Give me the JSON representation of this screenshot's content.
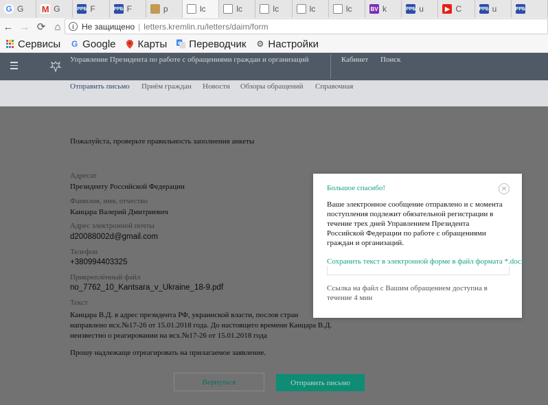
{
  "browser": {
    "tabs": [
      {
        "icon": "google-icon",
        "glyph": "G",
        "title": "G"
      },
      {
        "icon": "gmail-icon",
        "glyph": "M",
        "title": "G"
      },
      {
        "icon": "pf-icon",
        "glyph": "PPБ",
        "title": "F"
      },
      {
        "icon": "pf-icon",
        "glyph": "PPБ",
        "title": "F"
      },
      {
        "icon": "image-icon",
        "glyph": "",
        "title": "p"
      },
      {
        "icon": "document-icon",
        "glyph": "",
        "title": "lc"
      },
      {
        "icon": "document-icon",
        "glyph": "",
        "title": "lc"
      },
      {
        "icon": "document-icon",
        "glyph": "",
        "title": "lc"
      },
      {
        "icon": "document-icon",
        "glyph": "",
        "title": "lc"
      },
      {
        "icon": "document-icon",
        "glyph": "",
        "title": "lc"
      },
      {
        "icon": "bv-icon",
        "glyph": "BV",
        "title": "k"
      },
      {
        "icon": "pf-icon",
        "glyph": "PPБ",
        "title": "u"
      },
      {
        "icon": "youtube-icon",
        "glyph": "▶",
        "title": "C"
      },
      {
        "icon": "pf-icon",
        "glyph": "PPБ",
        "title": "u"
      },
      {
        "icon": "pf-icon",
        "glyph": "PPБ",
        "title": ""
      }
    ],
    "back": "←",
    "forward": "→",
    "reload": "⟳",
    "home": "⌂",
    "security_label": "Не защищено",
    "url": "letters.kremlin.ru/letters/daim/form"
  },
  "bookmarks": [
    {
      "label": "Сервисы",
      "icon": "apps-grid-icon"
    },
    {
      "label": "Google",
      "icon": "google-icon"
    },
    {
      "label": "Карты",
      "icon": "map-pin-icon"
    },
    {
      "label": "Переводчик",
      "icon": "translate-icon"
    },
    {
      "label": "Настройки",
      "icon": "gear-icon"
    }
  ],
  "site": {
    "title": "Управление Президента по работе с обращениями граждан и организаций",
    "cabinet": "Кабинет",
    "search": "Поиск",
    "nav": [
      {
        "label": "Отправить письмо",
        "active": true
      },
      {
        "label": "Приём граждан",
        "active": false
      },
      {
        "label": "Новости",
        "active": false
      },
      {
        "label": "Обзоры обращений",
        "active": false
      },
      {
        "label": "Справочная",
        "active": false
      }
    ]
  },
  "form": {
    "note": "Пожалуйста, проверьте правильность заполнения анкеты",
    "addressee_label": "Адресат",
    "addressee_value": "Президенту Российской Федерации",
    "name_label": "Фамилия, имя, отчество",
    "name_value": "Канцара Валерий Дмитриевич",
    "email_label": "Адрес электронной почты",
    "email_value": "d20088002d@gmail.com",
    "phone_label": "Телефон",
    "phone_value": "+380994403325",
    "file_label": "Прикреплённый файл",
    "file_value": "no_7762_10_Kantsara_v_Ukraine_18-9.pdf",
    "text_label": "Текст",
    "text_value": "Канцара В.Д. в адрес президента РФ, украинской власти, послов стран\nнаправлено исх.№17-26 от 15.01.2018 года. До настоящего времени Канцара В.Д.\nнеизвестно о реагировании на исх.№17-26 от 15.01.2018 года",
    "request": "Прошу надлежаще отреагировать на прилагаемое заявление.",
    "back_button": "Вернуться",
    "send_button": "Отправить письмо"
  },
  "modal": {
    "title": "Большое спасибо!",
    "close": "×",
    "body": "Ваше электронное сообщение отправлено и с момента поступления подлежит обязательной регистрации в течение трех дней Управлением Президента Российской Федерации по работе с обращениями граждан и организаций.",
    "save_link": "Сохранить текст в электронной форме в файл формата *.docx",
    "footer": "Ссылка на файл с Вашим обращением доступна в течение 4 мин"
  },
  "colors": {
    "accent": "#16a085",
    "header_bg": "#505a66",
    "overlay": "#727272"
  }
}
